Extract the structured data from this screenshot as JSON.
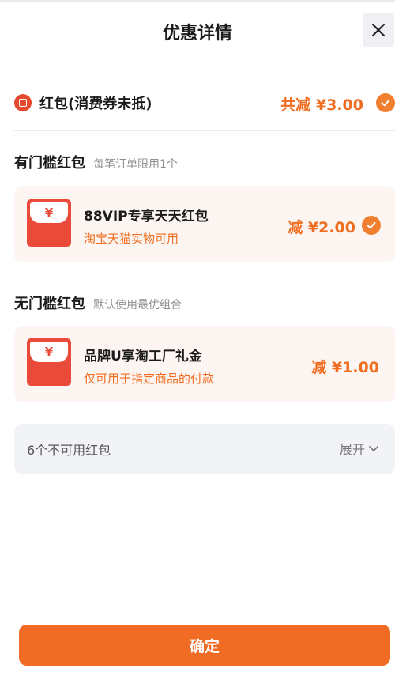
{
  "header": {
    "title": "优惠详情",
    "close_icon": "close-icon"
  },
  "summary": {
    "label": "红包(消费券未抵)",
    "total": "共减 ¥3.00",
    "selected": true
  },
  "sections": [
    {
      "title": "有门槛红包",
      "subtitle": "每笔订单限用1个",
      "card": {
        "symbol": "¥",
        "title": "88VIP专享天天红包",
        "subtitle": "淘宝天猫实物可用",
        "amount": "减 ¥2.00",
        "selected": true
      }
    },
    {
      "title": "无门槛红包",
      "subtitle": "默认使用最优组合",
      "card": {
        "symbol": "¥",
        "title": "品牌U享淘工厂礼金",
        "subtitle": "仅可用于指定商品的付款",
        "amount": "减 ¥1.00",
        "selected": false
      }
    }
  ],
  "unavailable": {
    "label": "6个不可用红包",
    "expand_label": "展开"
  },
  "footer": {
    "confirm_label": "确定"
  },
  "colors": {
    "accent": "#f06c24",
    "red": "#e94a3a",
    "card_bg": "#fcf5f2"
  }
}
